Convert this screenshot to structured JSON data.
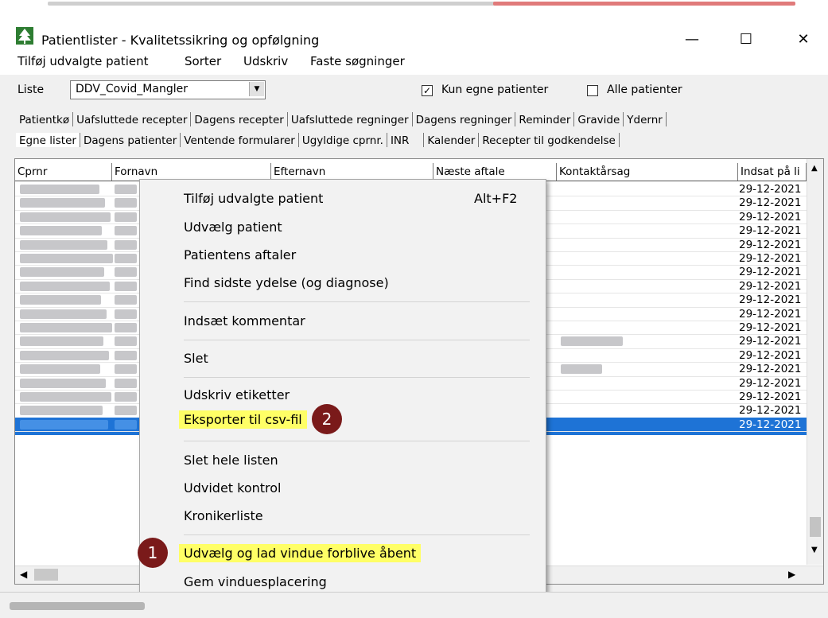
{
  "window": {
    "title": "Patientlister - Kvalitetssikring og opfølgning",
    "minimize_glyph": "—",
    "maximize_glyph": "☐",
    "close_glyph": "✕",
    "icon": "tree-app-icon"
  },
  "menubar": [
    "Tilføj udvalgte patient",
    "Sorter",
    "Udskriv",
    "Faste søgninger"
  ],
  "filters": {
    "liste_label": "Liste",
    "liste_value": "DDV_Covid_Mangler",
    "kun_egne_label": "Kun egne patienter",
    "kun_egne_checked": true,
    "alle_label": "Alle patienter",
    "alle_checked": false
  },
  "tabs_row1": [
    "Patientkø",
    "Uafsluttede recepter",
    "Dagens recepter",
    "Uafsluttede regninger",
    "Dagens regninger",
    "Reminder",
    "Gravide",
    "Ydernr"
  ],
  "tabs_row2": [
    "Egne lister",
    "Dagens patienter",
    "Ventende formularer",
    "Ugyldige cprnr.",
    "INR",
    "Kalender",
    "Recepter til godkendelse"
  ],
  "grid": {
    "columns": [
      "Cprnr",
      "Fornavn",
      "Efternavn",
      "Næste aftale",
      "Kontaktårsag",
      "Indsat på li"
    ],
    "dates": [
      "29-12-2021",
      "29-12-2021",
      "29-12-2021",
      "29-12-2021",
      "29-12-2021",
      "29-12-2021",
      "29-12-2021",
      "29-12-2021",
      "29-12-2021",
      "29-12-2021",
      "29-12-2021",
      "29-12-2021",
      "29-12-2021",
      "29-12-2021",
      "29-12-2021",
      "29-12-2021",
      "29-12-2021",
      "29-12-2021"
    ]
  },
  "context_menu": {
    "items": [
      {
        "label": "Tilføj udvalgte patient",
        "shortcut": "Alt+F2"
      },
      {
        "label": "Udvælg patient"
      },
      {
        "label": "Patientens aftaler"
      },
      {
        "label": "Find sidste ydelse (og diagnose)"
      },
      {
        "label": "Indsæt kommentar"
      },
      {
        "label": "Slet"
      },
      {
        "label": "Udskriv etiketter"
      },
      {
        "label": "Eksporter til csv-fil"
      },
      {
        "label": "Slet hele listen"
      },
      {
        "label": "Udvidet kontrol"
      },
      {
        "label": "Kronikerliste"
      },
      {
        "label": "Udvælg og lad vindue forblive åbent"
      },
      {
        "label": "Gem vinduesplacering"
      }
    ]
  },
  "badges": {
    "first": "1",
    "second": "2"
  },
  "colors": {
    "highlight": "#ffff66",
    "badge": "#7a1a1a",
    "selected_row": "#1e73d6"
  }
}
